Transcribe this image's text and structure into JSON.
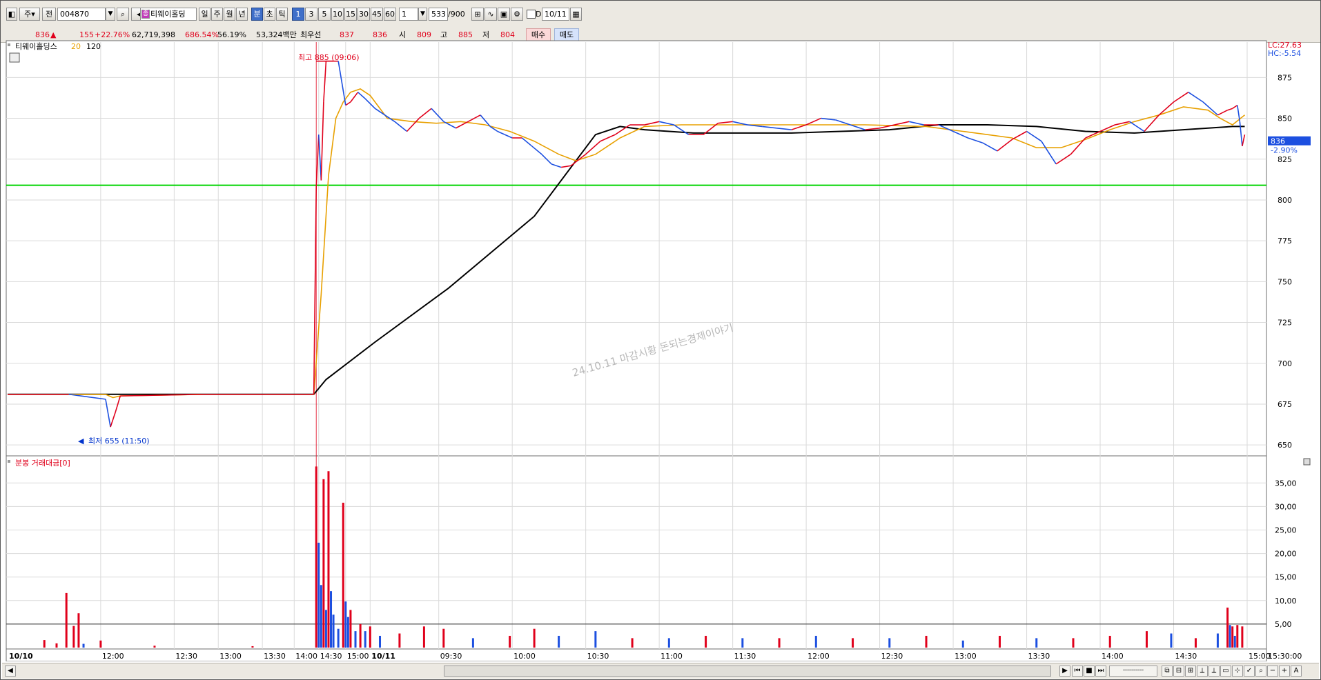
{
  "toolbar": {
    "market": "주",
    "code_prefix": "전",
    "code": "004870",
    "stock_name": "티웨이홀딩",
    "period_tabs": [
      "일",
      "주",
      "월",
      "년",
      "분",
      "초",
      "틱"
    ],
    "minute_buttons": [
      "1",
      "3",
      "5",
      "10",
      "15",
      "30",
      "45",
      "60"
    ],
    "interval": "1",
    "count": "533",
    "count_max": "/900",
    "d_label": "D",
    "date": "10/11"
  },
  "quote": {
    "price": "836",
    "arrow": "▲",
    "change": "155",
    "change_pct": "+22.76%",
    "volume": "62,719,398",
    "vol_ratio": "686.54%",
    "turnover_rate": "56.19%",
    "amount": "53,324백만",
    "best_ask_label": "최우선",
    "best_ask": "837",
    "best_bid": "836",
    "open_label": "시",
    "open": "809",
    "high_label": "고",
    "high": "885",
    "low_label": "저",
    "low": "804",
    "buy_label": "매수",
    "sell_label": "매도"
  },
  "chart_data": {
    "type": "line",
    "colors": {
      "up": "#e0001b",
      "down": "#1c4fe0",
      "ma20": "#e8a000",
      "ma120": "#000000",
      "ref_line": "#00d400"
    },
    "price_panel": {
      "title": "티웨이홀딩스",
      "ma_labels": [
        "20",
        "120"
      ],
      "ylim": [
        645,
        895
      ],
      "yticks": [
        875,
        850,
        825,
        800,
        775,
        750,
        725,
        700,
        675,
        650
      ],
      "current_price": "836",
      "current_pct": "-2.90%",
      "lc": "LC:27.63",
      "hc": "HC:-5.54",
      "reference_price": 809,
      "high_annotation": "최고 885 (09:06)",
      "low_annotation": "최저 655 (11:50)",
      "watermark": "24.10.11 마감시황 돈되는경제이야기",
      "close_series": {
        "x": [
          0,
          25,
          40,
          42,
          44,
          46,
          80,
          125,
          126,
          127,
          128,
          129,
          130,
          131,
          133,
          135,
          138,
          140,
          143,
          146,
          150,
          154,
          158,
          163,
          168,
          173,
          178,
          183,
          188,
          193,
          197,
          200,
          203,
          206,
          210,
          214,
          218,
          222,
          226,
          230,
          236,
          242,
          248,
          254,
          260,
          266,
          272,
          278,
          284,
          290,
          296,
          302,
          308,
          314,
          320,
          326,
          332,
          338,
          344,
          350,
          356,
          362,
          368,
          374,
          380,
          386,
          392,
          398,
          404,
          410,
          416,
          422,
          428,
          434,
          440,
          446,
          452,
          458,
          464,
          470,
          476,
          482,
          488,
          494,
          498,
          500,
          502,
          503,
          504,
          505
        ],
        "y": [
          681,
          681,
          678,
          661,
          670,
          680,
          681,
          681,
          808,
          840,
          812,
          860,
          885,
          885,
          885,
          885,
          858,
          860,
          866,
          862,
          856,
          852,
          848,
          842,
          850,
          856,
          848,
          844,
          848,
          852,
          845,
          842,
          840,
          838,
          838,
          833,
          828,
          822,
          820,
          821,
          828,
          836,
          840,
          846,
          846,
          848,
          846,
          840,
          840,
          847,
          848,
          846,
          845,
          844,
          843,
          846,
          850,
          849,
          846,
          843,
          844,
          846,
          848,
          846,
          846,
          842,
          838,
          835,
          830,
          837,
          842,
          836,
          822,
          828,
          838,
          842,
          846,
          848,
          842,
          852,
          860,
          866,
          860,
          852,
          855,
          856,
          858,
          848,
          833,
          840,
          882,
          884,
          874,
          866,
          852,
          840,
          836
        ]
      },
      "ma20_series": {
        "x": [
          0,
          25,
          40,
          43,
          46,
          80,
          125,
          128,
          131,
          134,
          137,
          140,
          144,
          148,
          155,
          165,
          175,
          185,
          195,
          205,
          215,
          225,
          232,
          240,
          250,
          260,
          275,
          300,
          325,
          350,
          375,
          390,
          400,
          410,
          420,
          430,
          440,
          450,
          460,
          470,
          480,
          490,
          495,
          500,
          505
        ],
        "y": [
          681,
          681,
          681,
          679,
          680,
          681,
          681,
          742,
          815,
          850,
          860,
          866,
          868,
          864,
          850,
          848,
          847,
          848,
          846,
          842,
          836,
          828,
          824,
          828,
          838,
          845,
          846,
          846,
          846,
          846,
          845,
          842,
          840,
          838,
          832,
          832,
          837,
          843,
          848,
          852,
          857,
          855,
          850,
          846,
          852
        ]
      },
      "ma120_series": {
        "x": [
          0,
          125,
          130,
          150,
          180,
          215,
          240,
          250,
          260,
          280,
          320,
          360,
          380,
          400,
          420,
          440,
          460,
          480,
          500,
          505
        ],
        "y": [
          681,
          681,
          690,
          713,
          746,
          790,
          840,
          845,
          843,
          841,
          841,
          843,
          846,
          846,
          845,
          842,
          841,
          843,
          845,
          845
        ]
      }
    },
    "volume_panel": {
      "title": "분봉 거래대금[0]",
      "ylim": [
        0,
        39
      ],
      "yticks": [
        "35,00",
        "30,00",
        "25,00",
        "20,00",
        "15,00",
        "10,00",
        "5,00"
      ],
      "ytick_values": [
        35,
        30,
        25,
        20,
        15,
        10,
        5
      ],
      "reference_level": 5,
      "bars": [
        {
          "x": 15,
          "v": 1.6,
          "up": true
        },
        {
          "x": 20,
          "v": 0.9,
          "up": true
        },
        {
          "x": 24,
          "v": 11.6,
          "up": true
        },
        {
          "x": 27,
          "v": 4.6,
          "up": true
        },
        {
          "x": 29,
          "v": 7.3,
          "up": true
        },
        {
          "x": 31,
          "v": 0.8,
          "up": false
        },
        {
          "x": 38,
          "v": 1.5,
          "up": true
        },
        {
          "x": 60,
          "v": 0.4,
          "up": true
        },
        {
          "x": 100,
          "v": 0.3,
          "up": true
        },
        {
          "x": 126,
          "v": 38.5,
          "up": true
        },
        {
          "x": 127,
          "v": 22.3,
          "up": false
        },
        {
          "x": 128,
          "v": 13.3,
          "up": false
        },
        {
          "x": 129,
          "v": 35.8,
          "up": true
        },
        {
          "x": 130,
          "v": 8.0,
          "up": false
        },
        {
          "x": 131,
          "v": 37.5,
          "up": true
        },
        {
          "x": 132,
          "v": 12.0,
          "up": false
        },
        {
          "x": 133,
          "v": 7.0,
          "up": false
        },
        {
          "x": 135,
          "v": 4.0,
          "up": false
        },
        {
          "x": 137,
          "v": 30.8,
          "up": true
        },
        {
          "x": 138,
          "v": 9.8,
          "up": false
        },
        {
          "x": 139,
          "v": 6.5,
          "up": false
        },
        {
          "x": 140,
          "v": 8.0,
          "up": true
        },
        {
          "x": 142,
          "v": 3.5,
          "up": false
        },
        {
          "x": 144,
          "v": 5.0,
          "up": true
        },
        {
          "x": 146,
          "v": 3.5,
          "up": false
        },
        {
          "x": 148,
          "v": 4.5,
          "up": true
        },
        {
          "x": 152,
          "v": 2.5,
          "up": false
        },
        {
          "x": 160,
          "v": 3.0,
          "up": true
        },
        {
          "x": 170,
          "v": 4.5,
          "up": true
        },
        {
          "x": 178,
          "v": 4.0,
          "up": true
        },
        {
          "x": 190,
          "v": 2.0,
          "up": false
        },
        {
          "x": 205,
          "v": 2.5,
          "up": true
        },
        {
          "x": 215,
          "v": 4.0,
          "up": true
        },
        {
          "x": 225,
          "v": 2.5,
          "up": false
        },
        {
          "x": 240,
          "v": 3.5,
          "up": false
        },
        {
          "x": 255,
          "v": 2.0,
          "up": true
        },
        {
          "x": 270,
          "v": 2.0,
          "up": false
        },
        {
          "x": 285,
          "v": 2.5,
          "up": true
        },
        {
          "x": 300,
          "v": 2.0,
          "up": false
        },
        {
          "x": 315,
          "v": 2.0,
          "up": true
        },
        {
          "x": 330,
          "v": 2.5,
          "up": false
        },
        {
          "x": 345,
          "v": 2.0,
          "up": true
        },
        {
          "x": 360,
          "v": 2.0,
          "up": false
        },
        {
          "x": 375,
          "v": 2.5,
          "up": true
        },
        {
          "x": 390,
          "v": 1.5,
          "up": false
        },
        {
          "x": 405,
          "v": 2.5,
          "up": true
        },
        {
          "x": 420,
          "v": 2.0,
          "up": false
        },
        {
          "x": 435,
          "v": 2.0,
          "up": true
        },
        {
          "x": 450,
          "v": 2.5,
          "up": true
        },
        {
          "x": 465,
          "v": 3.5,
          "up": true
        },
        {
          "x": 475,
          "v": 3.0,
          "up": false
        },
        {
          "x": 485,
          "v": 2.0,
          "up": true
        },
        {
          "x": 494,
          "v": 3.0,
          "up": false
        },
        {
          "x": 498,
          "v": 8.5,
          "up": true
        },
        {
          "x": 499,
          "v": 4.8,
          "up": false
        },
        {
          "x": 500,
          "v": 4.5,
          "up": true
        },
        {
          "x": 501,
          "v": 2.5,
          "up": false
        },
        {
          "x": 502,
          "v": 4.8,
          "up": true
        },
        {
          "x": 504,
          "v": 4.5,
          "up": true
        }
      ]
    },
    "x_axis": {
      "labels": [
        "10/10",
        "12:00",
        "12:30",
        "13:00",
        "13:30",
        "14:00",
        "14:30",
        "15:00",
        "10/11",
        "09:30",
        "10:00",
        "10:30",
        "11:00",
        "11:30",
        "12:00",
        "12:30",
        "13:00",
        "13:30",
        "14:00",
        "14:30",
        "15:00"
      ],
      "positions": [
        0,
        38,
        68,
        86,
        104,
        117,
        127,
        138,
        148,
        176,
        206,
        236,
        266,
        296,
        326,
        356,
        386,
        416,
        446,
        476,
        506
      ],
      "end_label": "15:30:00"
    }
  }
}
